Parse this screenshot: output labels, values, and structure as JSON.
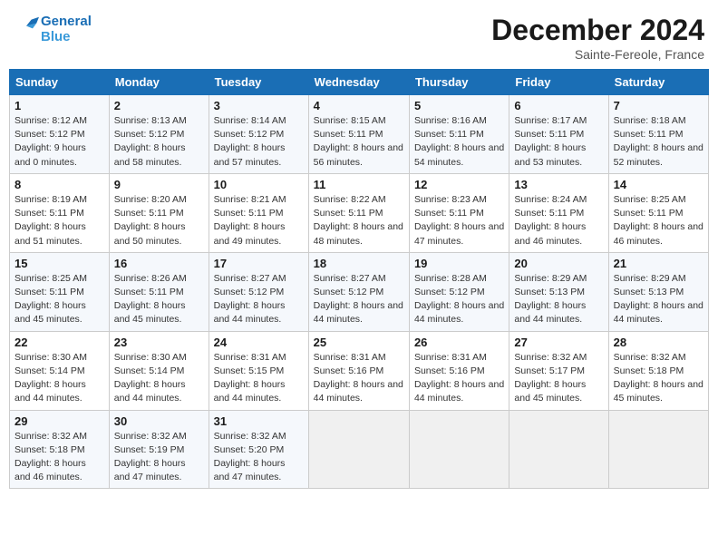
{
  "header": {
    "logo_line1": "General",
    "logo_line2": "Blue",
    "month": "December 2024",
    "location": "Sainte-Fereole, France"
  },
  "weekdays": [
    "Sunday",
    "Monday",
    "Tuesday",
    "Wednesday",
    "Thursday",
    "Friday",
    "Saturday"
  ],
  "weeks": [
    [
      {
        "day": "1",
        "detail": "Sunrise: 8:12 AM\nSunset: 5:12 PM\nDaylight: 9 hours and 0 minutes."
      },
      {
        "day": "2",
        "detail": "Sunrise: 8:13 AM\nSunset: 5:12 PM\nDaylight: 8 hours and 58 minutes."
      },
      {
        "day": "3",
        "detail": "Sunrise: 8:14 AM\nSunset: 5:12 PM\nDaylight: 8 hours and 57 minutes."
      },
      {
        "day": "4",
        "detail": "Sunrise: 8:15 AM\nSunset: 5:11 PM\nDaylight: 8 hours and 56 minutes."
      },
      {
        "day": "5",
        "detail": "Sunrise: 8:16 AM\nSunset: 5:11 PM\nDaylight: 8 hours and 54 minutes."
      },
      {
        "day": "6",
        "detail": "Sunrise: 8:17 AM\nSunset: 5:11 PM\nDaylight: 8 hours and 53 minutes."
      },
      {
        "day": "7",
        "detail": "Sunrise: 8:18 AM\nSunset: 5:11 PM\nDaylight: 8 hours and 52 minutes."
      }
    ],
    [
      {
        "day": "8",
        "detail": "Sunrise: 8:19 AM\nSunset: 5:11 PM\nDaylight: 8 hours and 51 minutes."
      },
      {
        "day": "9",
        "detail": "Sunrise: 8:20 AM\nSunset: 5:11 PM\nDaylight: 8 hours and 50 minutes."
      },
      {
        "day": "10",
        "detail": "Sunrise: 8:21 AM\nSunset: 5:11 PM\nDaylight: 8 hours and 49 minutes."
      },
      {
        "day": "11",
        "detail": "Sunrise: 8:22 AM\nSunset: 5:11 PM\nDaylight: 8 hours and 48 minutes."
      },
      {
        "day": "12",
        "detail": "Sunrise: 8:23 AM\nSunset: 5:11 PM\nDaylight: 8 hours and 47 minutes."
      },
      {
        "day": "13",
        "detail": "Sunrise: 8:24 AM\nSunset: 5:11 PM\nDaylight: 8 hours and 46 minutes."
      },
      {
        "day": "14",
        "detail": "Sunrise: 8:25 AM\nSunset: 5:11 PM\nDaylight: 8 hours and 46 minutes."
      }
    ],
    [
      {
        "day": "15",
        "detail": "Sunrise: 8:25 AM\nSunset: 5:11 PM\nDaylight: 8 hours and 45 minutes."
      },
      {
        "day": "16",
        "detail": "Sunrise: 8:26 AM\nSunset: 5:11 PM\nDaylight: 8 hours and 45 minutes."
      },
      {
        "day": "17",
        "detail": "Sunrise: 8:27 AM\nSunset: 5:12 PM\nDaylight: 8 hours and 44 minutes."
      },
      {
        "day": "18",
        "detail": "Sunrise: 8:27 AM\nSunset: 5:12 PM\nDaylight: 8 hours and 44 minutes."
      },
      {
        "day": "19",
        "detail": "Sunrise: 8:28 AM\nSunset: 5:12 PM\nDaylight: 8 hours and 44 minutes."
      },
      {
        "day": "20",
        "detail": "Sunrise: 8:29 AM\nSunset: 5:13 PM\nDaylight: 8 hours and 44 minutes."
      },
      {
        "day": "21",
        "detail": "Sunrise: 8:29 AM\nSunset: 5:13 PM\nDaylight: 8 hours and 44 minutes."
      }
    ],
    [
      {
        "day": "22",
        "detail": "Sunrise: 8:30 AM\nSunset: 5:14 PM\nDaylight: 8 hours and 44 minutes."
      },
      {
        "day": "23",
        "detail": "Sunrise: 8:30 AM\nSunset: 5:14 PM\nDaylight: 8 hours and 44 minutes."
      },
      {
        "day": "24",
        "detail": "Sunrise: 8:31 AM\nSunset: 5:15 PM\nDaylight: 8 hours and 44 minutes."
      },
      {
        "day": "25",
        "detail": "Sunrise: 8:31 AM\nSunset: 5:16 PM\nDaylight: 8 hours and 44 minutes."
      },
      {
        "day": "26",
        "detail": "Sunrise: 8:31 AM\nSunset: 5:16 PM\nDaylight: 8 hours and 44 minutes."
      },
      {
        "day": "27",
        "detail": "Sunrise: 8:32 AM\nSunset: 5:17 PM\nDaylight: 8 hours and 45 minutes."
      },
      {
        "day": "28",
        "detail": "Sunrise: 8:32 AM\nSunset: 5:18 PM\nDaylight: 8 hours and 45 minutes."
      }
    ],
    [
      {
        "day": "29",
        "detail": "Sunrise: 8:32 AM\nSunset: 5:18 PM\nDaylight: 8 hours and 46 minutes."
      },
      {
        "day": "30",
        "detail": "Sunrise: 8:32 AM\nSunset: 5:19 PM\nDaylight: 8 hours and 47 minutes."
      },
      {
        "day": "31",
        "detail": "Sunrise: 8:32 AM\nSunset: 5:20 PM\nDaylight: 8 hours and 47 minutes."
      },
      null,
      null,
      null,
      null
    ]
  ]
}
